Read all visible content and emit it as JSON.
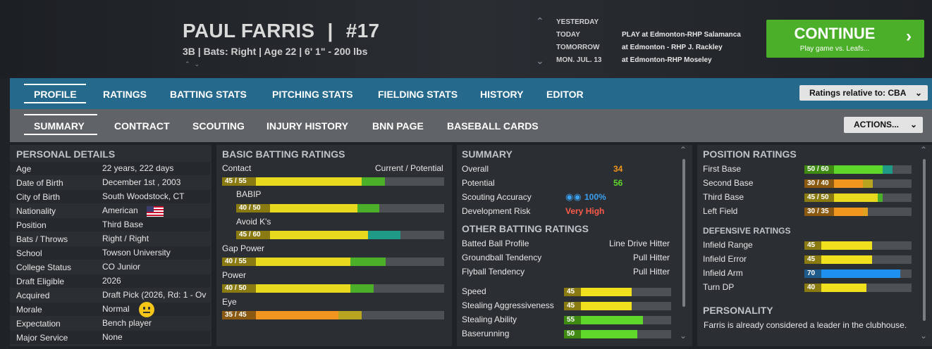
{
  "player": {
    "name": "PAUL FARRIS",
    "sep": "|",
    "number": "#17",
    "subline": "3B | Bats: Right  |  Age 22  |  6' 1\"  - 200 lbs",
    "nav": "^ v"
  },
  "schedule": [
    {
      "day": "YESTERDAY",
      "game": ""
    },
    {
      "day": "TODAY",
      "game": "PLAY at Edmonton-RHP Salamanca"
    },
    {
      "day": "TOMORROW",
      "game": "at Edmonton - RHP J. Rackley"
    },
    {
      "day": "MON. JUL. 13",
      "game": "at Edmonton-RHP Moseley"
    }
  ],
  "continue": {
    "label": "CONTINUE",
    "sub": "Play game vs. Leafs...",
    "chevron": "›"
  },
  "main_tabs": [
    "PROFILE",
    "RATINGS",
    "BATTING STATS",
    "PITCHING STATS",
    "FIELDING STATS",
    "HISTORY",
    "EDITOR"
  ],
  "ratings_relative": "Ratings relative to: CBA",
  "sub_tabs": [
    "SUMMARY",
    "CONTRACT",
    "SCOUTING",
    "INJURY HISTORY",
    "BNN PAGE",
    "BASEBALL CARDS"
  ],
  "actions_label": "ACTIONS...",
  "personal": {
    "title": "PERSONAL DETAILS",
    "rows": [
      {
        "label": "Age",
        "value": "22 years, 222 days"
      },
      {
        "label": "Date of Birth",
        "value": "December 1st , 2003"
      },
      {
        "label": "City of Birth",
        "value": "South Woodstock, CT"
      },
      {
        "label": "Nationality",
        "value": "American"
      },
      {
        "label": "Position",
        "value": "Third Base"
      },
      {
        "label": "Bats / Throws",
        "value": "Right / Right"
      },
      {
        "label": "School",
        "value": "Towson University"
      },
      {
        "label": "College Status",
        "value": "CO Junior"
      },
      {
        "label": "Draft Eligible",
        "value": "2026"
      },
      {
        "label": "Acquired",
        "value": "Draft Pick (2026, Rd: 1 - Ov"
      },
      {
        "label": "Morale",
        "value": "Normal"
      },
      {
        "label": "Expectation",
        "value": "Bench player"
      },
      {
        "label": "Major Service",
        "value": "None"
      }
    ]
  },
  "batting": {
    "title": "BASIC BATTING RATINGS",
    "col_label": "Current / Potential",
    "rows": [
      {
        "label": "Contact",
        "badge": "45 / 55",
        "cur": 45,
        "pot": 55,
        "badge_color": "#8a7a12",
        "cur_color": "#e8d81e",
        "pot_color": "#4caf2a"
      },
      {
        "label": "BABIP",
        "badge": "40 / 50",
        "cur": 40,
        "pot": 50,
        "badge_color": "#8a7a12",
        "cur_color": "#e8d81e",
        "pot_color": "#4caf2a"
      },
      {
        "label": "Avoid K's",
        "badge": "45 / 60",
        "cur": 45,
        "pot": 60,
        "badge_color": "#8a7a12",
        "cur_color": "#e8d81e",
        "pot_color": "#1e9a86"
      },
      {
        "label": "Gap Power",
        "badge": "40 / 55",
        "cur": 40,
        "pot": 55,
        "badge_color": "#8a7a12",
        "cur_color": "#e8d81e",
        "pot_color": "#4caf2a"
      },
      {
        "label": "Power",
        "badge": "40 / 50",
        "cur": 40,
        "pot": 50,
        "badge_color": "#8a7a12",
        "cur_color": "#e8d81e",
        "pot_color": "#4caf2a"
      },
      {
        "label": "Eye",
        "badge": "35 / 45",
        "cur": 35,
        "pot": 45,
        "badge_color": "#8a5a12",
        "cur_color": "#f0961e",
        "pot_color": "#b8a41e"
      }
    ]
  },
  "summary": {
    "title": "SUMMARY",
    "rows": [
      {
        "label": "Overall",
        "value": "34",
        "color": "#f0961e"
      },
      {
        "label": "Potential",
        "value": "56",
        "color": "#5ed62a"
      },
      {
        "label": "Scouting Accuracy",
        "value": "100%",
        "color": "#3aa0f0"
      },
      {
        "label": "Development Risk",
        "value": "Very High",
        "color": "#ff5a4a"
      }
    ],
    "other_title": "OTHER BATTING RATINGS",
    "other": [
      {
        "label": "Batted Ball Profile",
        "value": "Line Drive Hitter"
      },
      {
        "label": "Groundball Tendency",
        "value": "Pull Hitter"
      },
      {
        "label": "Flyball Tendency",
        "value": "Pull Hitter"
      }
    ],
    "speed": [
      {
        "label": "Speed",
        "value": "45",
        "level": 45,
        "badge_color": "#8a7a12",
        "color": "#f0e01e"
      },
      {
        "label": "Stealing Aggressiveness",
        "value": "45",
        "level": 45,
        "badge_color": "#8a7a12",
        "color": "#f0e01e"
      },
      {
        "label": "Stealing Ability",
        "value": "55",
        "level": 55,
        "badge_color": "#3e8a12",
        "color": "#5ed62a"
      },
      {
        "label": "Baserunning",
        "value": "50",
        "level": 50,
        "badge_color": "#3e8a12",
        "color": "#5ed62a"
      }
    ]
  },
  "position": {
    "title": "POSITION RATINGS",
    "rows": [
      {
        "label": "First Base",
        "badge": "50 / 60",
        "cur": 50,
        "pot": 60,
        "badge_color": "#3e8a12",
        "cur_color": "#5ed62a",
        "pot_color": "#1e9a86"
      },
      {
        "label": "Second Base",
        "badge": "30 / 40",
        "cur": 30,
        "pot": 40,
        "badge_color": "#8a5a12",
        "cur_color": "#f0961e",
        "pot_color": "#b8a41e"
      },
      {
        "label": "Third Base",
        "badge": "45 / 50",
        "cur": 45,
        "pot": 50,
        "badge_color": "#8a7a12",
        "cur_color": "#e8d81e",
        "pot_color": "#4caf2a"
      },
      {
        "label": "Left Field",
        "badge": "30 / 35",
        "cur": 30,
        "pot": 35,
        "badge_color": "#8a5a12",
        "cur_color": "#f0961e",
        "pot_color": "#e0a020"
      }
    ],
    "def_title": "DEFENSIVE RATINGS",
    "def": [
      {
        "label": "Infield Range",
        "value": "45",
        "level": 45,
        "badge_color": "#8a7a12",
        "color": "#f0e01e"
      },
      {
        "label": "Infield Error",
        "value": "45",
        "level": 45,
        "badge_color": "#8a7a12",
        "color": "#f0e01e"
      },
      {
        "label": "Infield Arm",
        "value": "70",
        "level": 70,
        "badge_color": "#1e5a8a",
        "color": "#1e90f0"
      },
      {
        "label": "Turn DP",
        "value": "40",
        "level": 40,
        "badge_color": "#8a7a12",
        "color": "#f0e01e"
      }
    ],
    "personality_title": "PERSONALITY",
    "personality_text": "Farris is already considered a leader in the clubhouse."
  }
}
